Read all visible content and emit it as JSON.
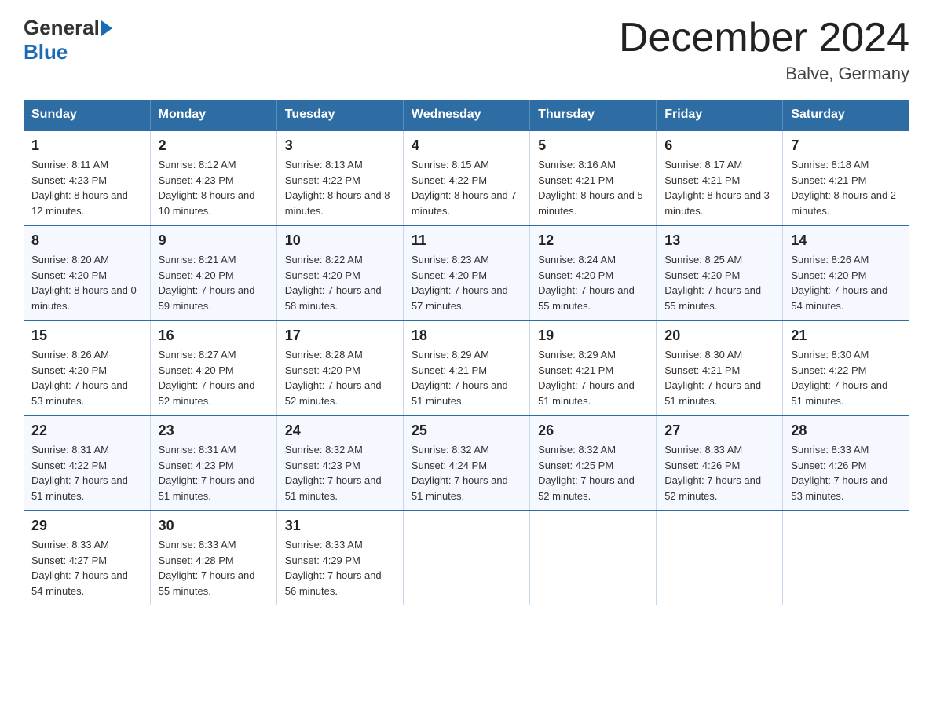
{
  "logo": {
    "general": "General",
    "blue": "Blue"
  },
  "title": "December 2024",
  "location": "Balve, Germany",
  "days_of_week": [
    "Sunday",
    "Monday",
    "Tuesday",
    "Wednesday",
    "Thursday",
    "Friday",
    "Saturday"
  ],
  "weeks": [
    [
      {
        "day": "1",
        "sunrise": "8:11 AM",
        "sunset": "4:23 PM",
        "daylight": "8 hours and 12 minutes."
      },
      {
        "day": "2",
        "sunrise": "8:12 AM",
        "sunset": "4:23 PM",
        "daylight": "8 hours and 10 minutes."
      },
      {
        "day": "3",
        "sunrise": "8:13 AM",
        "sunset": "4:22 PM",
        "daylight": "8 hours and 8 minutes."
      },
      {
        "day": "4",
        "sunrise": "8:15 AM",
        "sunset": "4:22 PM",
        "daylight": "8 hours and 7 minutes."
      },
      {
        "day": "5",
        "sunrise": "8:16 AM",
        "sunset": "4:21 PM",
        "daylight": "8 hours and 5 minutes."
      },
      {
        "day": "6",
        "sunrise": "8:17 AM",
        "sunset": "4:21 PM",
        "daylight": "8 hours and 3 minutes."
      },
      {
        "day": "7",
        "sunrise": "8:18 AM",
        "sunset": "4:21 PM",
        "daylight": "8 hours and 2 minutes."
      }
    ],
    [
      {
        "day": "8",
        "sunrise": "8:20 AM",
        "sunset": "4:20 PM",
        "daylight": "8 hours and 0 minutes."
      },
      {
        "day": "9",
        "sunrise": "8:21 AM",
        "sunset": "4:20 PM",
        "daylight": "7 hours and 59 minutes."
      },
      {
        "day": "10",
        "sunrise": "8:22 AM",
        "sunset": "4:20 PM",
        "daylight": "7 hours and 58 minutes."
      },
      {
        "day": "11",
        "sunrise": "8:23 AM",
        "sunset": "4:20 PM",
        "daylight": "7 hours and 57 minutes."
      },
      {
        "day": "12",
        "sunrise": "8:24 AM",
        "sunset": "4:20 PM",
        "daylight": "7 hours and 55 minutes."
      },
      {
        "day": "13",
        "sunrise": "8:25 AM",
        "sunset": "4:20 PM",
        "daylight": "7 hours and 55 minutes."
      },
      {
        "day": "14",
        "sunrise": "8:26 AM",
        "sunset": "4:20 PM",
        "daylight": "7 hours and 54 minutes."
      }
    ],
    [
      {
        "day": "15",
        "sunrise": "8:26 AM",
        "sunset": "4:20 PM",
        "daylight": "7 hours and 53 minutes."
      },
      {
        "day": "16",
        "sunrise": "8:27 AM",
        "sunset": "4:20 PM",
        "daylight": "7 hours and 52 minutes."
      },
      {
        "day": "17",
        "sunrise": "8:28 AM",
        "sunset": "4:20 PM",
        "daylight": "7 hours and 52 minutes."
      },
      {
        "day": "18",
        "sunrise": "8:29 AM",
        "sunset": "4:21 PM",
        "daylight": "7 hours and 51 minutes."
      },
      {
        "day": "19",
        "sunrise": "8:29 AM",
        "sunset": "4:21 PM",
        "daylight": "7 hours and 51 minutes."
      },
      {
        "day": "20",
        "sunrise": "8:30 AM",
        "sunset": "4:21 PM",
        "daylight": "7 hours and 51 minutes."
      },
      {
        "day": "21",
        "sunrise": "8:30 AM",
        "sunset": "4:22 PM",
        "daylight": "7 hours and 51 minutes."
      }
    ],
    [
      {
        "day": "22",
        "sunrise": "8:31 AM",
        "sunset": "4:22 PM",
        "daylight": "7 hours and 51 minutes."
      },
      {
        "day": "23",
        "sunrise": "8:31 AM",
        "sunset": "4:23 PM",
        "daylight": "7 hours and 51 minutes."
      },
      {
        "day": "24",
        "sunrise": "8:32 AM",
        "sunset": "4:23 PM",
        "daylight": "7 hours and 51 minutes."
      },
      {
        "day": "25",
        "sunrise": "8:32 AM",
        "sunset": "4:24 PM",
        "daylight": "7 hours and 51 minutes."
      },
      {
        "day": "26",
        "sunrise": "8:32 AM",
        "sunset": "4:25 PM",
        "daylight": "7 hours and 52 minutes."
      },
      {
        "day": "27",
        "sunrise": "8:33 AM",
        "sunset": "4:26 PM",
        "daylight": "7 hours and 52 minutes."
      },
      {
        "day": "28",
        "sunrise": "8:33 AM",
        "sunset": "4:26 PM",
        "daylight": "7 hours and 53 minutes."
      }
    ],
    [
      {
        "day": "29",
        "sunrise": "8:33 AM",
        "sunset": "4:27 PM",
        "daylight": "7 hours and 54 minutes."
      },
      {
        "day": "30",
        "sunrise": "8:33 AM",
        "sunset": "4:28 PM",
        "daylight": "7 hours and 55 minutes."
      },
      {
        "day": "31",
        "sunrise": "8:33 AM",
        "sunset": "4:29 PM",
        "daylight": "7 hours and 56 minutes."
      },
      null,
      null,
      null,
      null
    ]
  ]
}
